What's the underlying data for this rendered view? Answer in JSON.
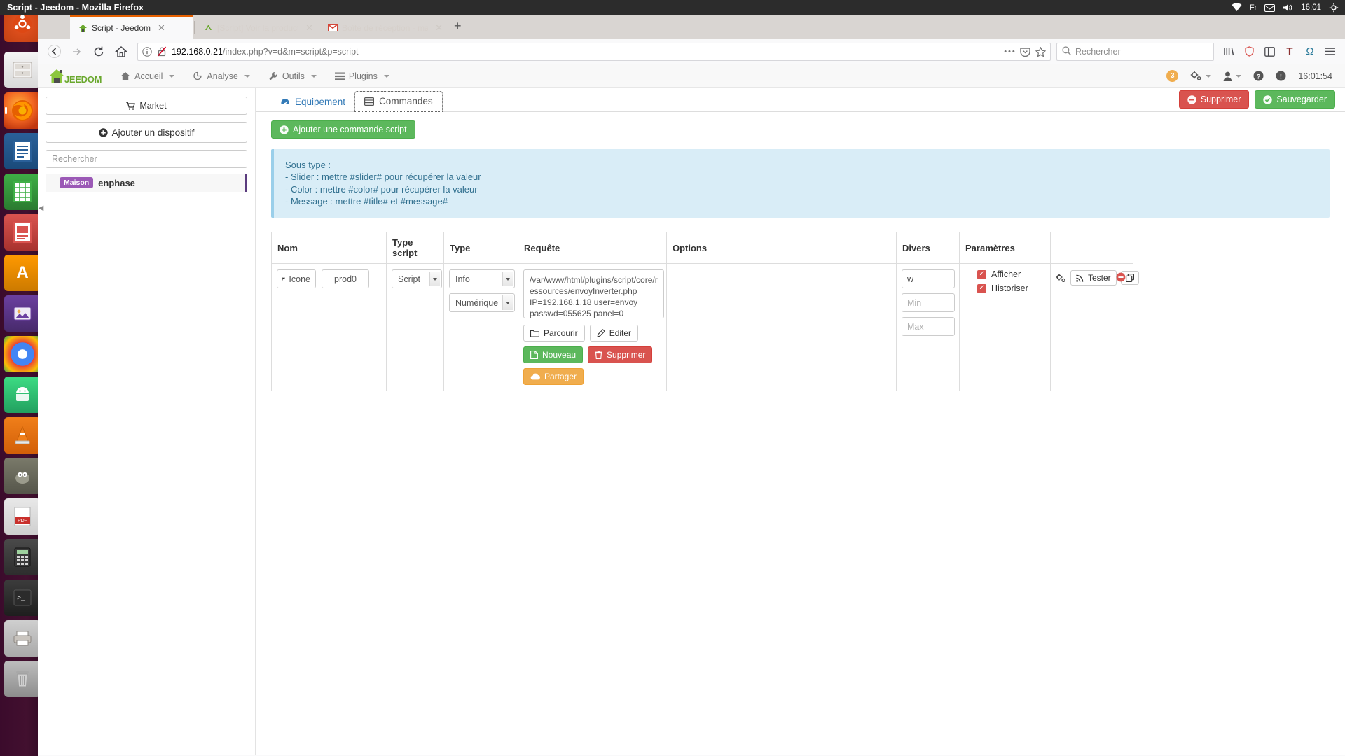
{
  "desktop": {
    "panel_title": "Script - Jeedom - Mozilla Firefox",
    "indicators": [
      {
        "name": "wifi-icon",
        "glyph": "◤"
      },
      {
        "name": "keyboard-layout-indicator",
        "label": "Fr"
      },
      {
        "name": "mail-icon",
        "glyph": "✉"
      },
      {
        "name": "volume-icon",
        "glyph": "🔊"
      },
      {
        "name": "power-icon",
        "glyph": "⏻"
      },
      {
        "name": "clock",
        "label": "16:01"
      },
      {
        "name": "gear-icon",
        "glyph": "⚙"
      }
    ],
    "launcher_items": [
      {
        "name": "launcher-ubuntu-dash",
        "class": "li-ubuntu",
        "glyph": ""
      },
      {
        "name": "launcher-files",
        "class": "li-files",
        "glyph": ""
      },
      {
        "name": "launcher-firefox",
        "class": "li-firefox",
        "glyph": "",
        "running": true
      },
      {
        "name": "launcher-libreoffice-writer",
        "class": "li-writer",
        "glyph": ""
      },
      {
        "name": "launcher-libreoffice-calc",
        "class": "li-calc",
        "glyph": ""
      },
      {
        "name": "launcher-libreoffice-impress",
        "class": "li-impress",
        "glyph": ""
      },
      {
        "name": "launcher-amazon",
        "class": "li-amazon",
        "glyph": "A"
      },
      {
        "name": "launcher-pix",
        "class": "li-pix",
        "glyph": ""
      },
      {
        "name": "launcher-chromium",
        "class": "li-chrome",
        "glyph": ""
      },
      {
        "name": "launcher-android-studio",
        "class": "li-android",
        "glyph": ""
      },
      {
        "name": "launcher-vlc",
        "class": "li-vlc",
        "glyph": ""
      },
      {
        "name": "launcher-gimp",
        "class": "li-gimp",
        "glyph": ""
      },
      {
        "name": "launcher-pdf-reader",
        "class": "li-pdf",
        "glyph": ""
      },
      {
        "name": "launcher-calculator",
        "class": "li-calcsm",
        "glyph": ""
      },
      {
        "name": "launcher-terminal",
        "class": "li-term",
        "glyph": ""
      },
      {
        "name": "launcher-printer",
        "class": "li-print",
        "glyph": ""
      },
      {
        "name": "launcher-trash",
        "class": "li-trash",
        "glyph": ""
      }
    ]
  },
  "browser": {
    "tabs": [
      {
        "title": "Script - Jeedom",
        "favicon": "jeedom-house-icon",
        "active": true
      },
      {
        "title": "[Script] Voir la productio",
        "favicon": "jeedom-chevron-icon",
        "active": false
      },
      {
        "title": "Boîte de réception - mai",
        "favicon": "gmail-icon",
        "active": false
      }
    ],
    "new_tab_label": "+",
    "url": "192.168.0.21/index.php?v=d&m=script&p=script",
    "url_host": "192.168.0.21",
    "url_path": "/index.php?v=d&m=script&p=script",
    "search_placeholder": "Rechercher",
    "nav_icons": [
      "back-icon",
      "forward-icon",
      "reload-icon",
      "home-icon"
    ],
    "url_icons": [
      "page-info-icon",
      "broken-lock-icon",
      "page-actions-icon",
      "pocket-icon",
      "bookmark-star-icon"
    ],
    "toolbar_icons": [
      "library-icon",
      "shield-icon",
      "sidebar-icon",
      "text-tool-icon",
      "omega-icon",
      "menu-icon"
    ]
  },
  "jeedom": {
    "brand": "JEEDOM",
    "nav": [
      {
        "label": "Accueil",
        "icon": "home-icon",
        "caret": true
      },
      {
        "label": "Analyse",
        "icon": "chart-icon",
        "caret": true
      },
      {
        "label": "Outils",
        "icon": "wrench-icon",
        "caret": true
      },
      {
        "label": "Plugins",
        "icon": "list-icon",
        "caret": true
      }
    ],
    "nav_right": {
      "message_count": "3",
      "icons": [
        {
          "name": "gears-dropdown-icon",
          "glyph": "⚙",
          "caret": true
        },
        {
          "name": "user-dropdown-icon",
          "glyph": "👤",
          "caret": true
        },
        {
          "name": "help-icon",
          "glyph": "?",
          "caret": false
        },
        {
          "name": "info-icon",
          "glyph": "!",
          "caret": false
        }
      ],
      "clock": "16:01:54"
    },
    "sidebar": {
      "market_label": "Market",
      "add_device_label": "Ajouter un dispositif",
      "search_placeholder": "Rechercher",
      "equipments": [
        {
          "group": "Maison",
          "name": "enphase"
        }
      ]
    },
    "tabs": [
      {
        "label": "Equipement",
        "icon": "dashboard-icon",
        "active": false
      },
      {
        "label": "Commandes",
        "icon": "table-icon",
        "active": true
      }
    ],
    "actions": {
      "delete_label": "Supprimer",
      "save_label": "Sauvegarder"
    },
    "add_command_label": "Ajouter une commande script",
    "info_panel": {
      "title": "Sous type :",
      "lines": [
        "- Slider : mettre #slider# pour récupérer la valeur",
        "- Color : mettre #color# pour récupérer la valeur",
        "- Message : mettre #title# et #message#"
      ]
    },
    "table": {
      "headers": [
        "Nom",
        "Type script",
        "Type",
        "Requête",
        "Options",
        "Divers",
        "Paramètres",
        ""
      ],
      "rows": [
        {
          "icon_button_label": "Icone",
          "name_value": "prod0",
          "type_script_value": "Script",
          "type_value": "Info",
          "subtype_value": "Numérique",
          "requete_value": "/var/www/html/plugins/script/core/ressources/envoyInverter.php IP=192.168.1.18 user=envoy passwd=055625 panel=0",
          "requete_buttons": [
            {
              "label": "Parcourir",
              "style": "default",
              "icon": "folder-icon"
            },
            {
              "label": "Editer",
              "style": "default",
              "icon": "pencil-icon"
            },
            {
              "label": "Nouveau",
              "style": "success",
              "icon": "file-icon"
            },
            {
              "label": "Supprimer",
              "style": "danger",
              "icon": "trash-icon"
            },
            {
              "label": "Partager",
              "style": "warning",
              "icon": "cloud-icon"
            }
          ],
          "options_value": "",
          "divers_unit": "w",
          "divers_min_placeholder": "Min",
          "divers_max_placeholder": "Max",
          "parametres": [
            {
              "label": "Afficher",
              "checked": true
            },
            {
              "label": "Historiser",
              "checked": true
            }
          ],
          "row_actions": [
            {
              "name": "configure-icon",
              "label": ""
            },
            {
              "name": "tester-button",
              "label": "Tester"
            },
            {
              "name": "duplicate-icon",
              "label": ""
            },
            {
              "name": "remove-row-icon",
              "label": ""
            }
          ]
        }
      ]
    }
  }
}
